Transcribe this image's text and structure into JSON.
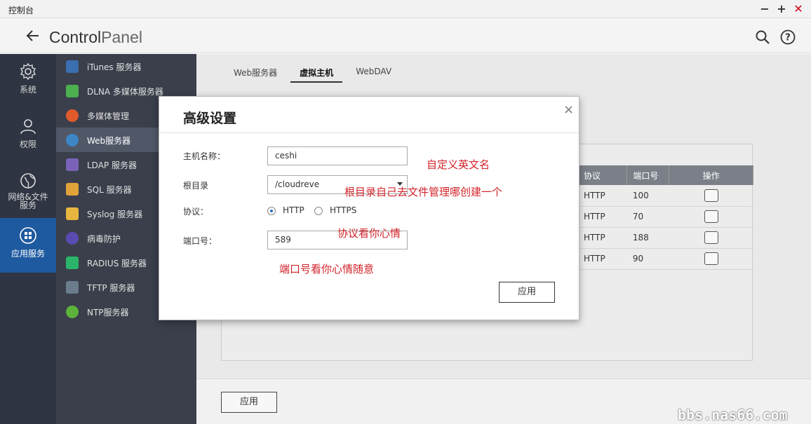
{
  "window": {
    "title": "控制台"
  },
  "header": {
    "title_bold": "Control",
    "title_light": "Panel"
  },
  "rail": {
    "items": [
      {
        "label": "系统",
        "icon": "gear-icon"
      },
      {
        "label": "权限",
        "icon": "user-icon"
      },
      {
        "label": "网络&文件服务",
        "icon": "globe-icon"
      },
      {
        "label": "应用服务",
        "icon": "apps-icon"
      }
    ]
  },
  "submenu": {
    "items": [
      {
        "label": "iTunes 服务器",
        "color": "#3a6fb0"
      },
      {
        "label": "DLNA 多媒体服务器",
        "color": "#4caf50"
      },
      {
        "label": "多媒体管理",
        "color": "#e05a2b"
      },
      {
        "label": "Web服务器",
        "color": "#3d86c6"
      },
      {
        "label": "LDAP 服务器",
        "color": "#7a62b8"
      },
      {
        "label": "SQL 服务器",
        "color": "#e2a23a"
      },
      {
        "label": "Syslog 服务器",
        "color": "#e8b640"
      },
      {
        "label": "病毒防护",
        "color": "#5a4bb0"
      },
      {
        "label": "RADIUS 服务器",
        "color": "#2bb56a"
      },
      {
        "label": "TFTP 服务器",
        "color": "#6b7c8c"
      },
      {
        "label": "NTP服务器",
        "color": "#5db33a"
      }
    ]
  },
  "tabs": [
    {
      "label": "Web服务器"
    },
    {
      "label": "虚拟主机"
    },
    {
      "label": "WebDAV"
    }
  ],
  "table": {
    "headers": [
      "协议",
      "端口号",
      "操作"
    ],
    "rows": [
      {
        "protocol": "HTTP",
        "port": "100"
      },
      {
        "protocol": "HTTP",
        "port": "70"
      },
      {
        "protocol": "HTTP",
        "port": "188"
      },
      {
        "protocol": "HTTP",
        "port": "90"
      }
    ]
  },
  "bottom": {
    "apply_label": "应用"
  },
  "dialog": {
    "title": "高级设置",
    "close": "×",
    "hostname_label": "主机名称：",
    "hostname_value": "ceshi",
    "root_label": "根目录",
    "root_value": "/cloudreve",
    "protocol_label": "协议：",
    "protocol_http": "HTTP",
    "protocol_https": "HTTPS",
    "port_label": "端口号：",
    "port_value": "589",
    "apply_label": "应用"
  },
  "notes": {
    "hostname": "自定义英文名",
    "root": "根目录自己去文件管理哪创建一个",
    "protocol": "协议看你心情",
    "port": "端口号看你心情随意"
  },
  "watermark": "bbs.nas66.com"
}
